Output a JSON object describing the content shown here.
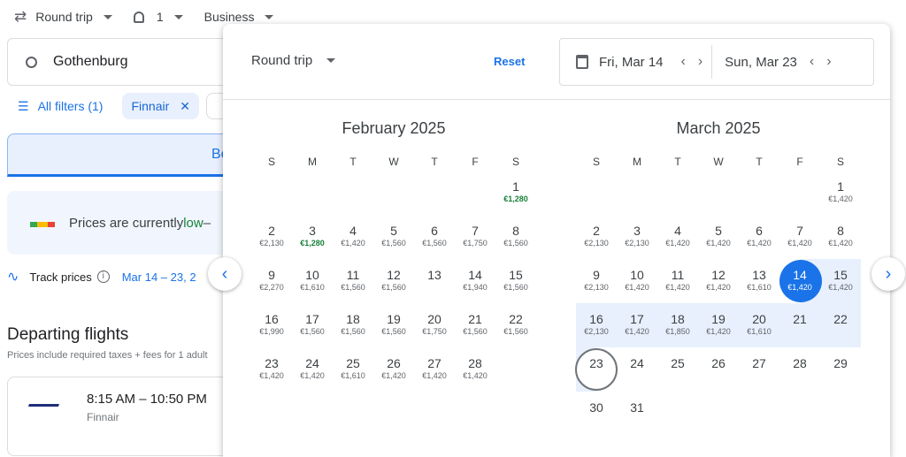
{
  "topbar": {
    "trip_type": "Round trip",
    "passengers": "1",
    "cabin": "Business"
  },
  "search": {
    "origin": "Gothenburg"
  },
  "filters": {
    "all_filters": "All filters (1)",
    "chip": "Finnair"
  },
  "tabs": {
    "best": "Be"
  },
  "insight": {
    "text_prefix": "Prices are currently ",
    "text_low": "low",
    "text_suffix": " –"
  },
  "track": {
    "label": "Track prices",
    "dates": "Mar 14 – 23, 2"
  },
  "departing": {
    "title": "Departing flights",
    "subtitle": "Prices include required taxes + fees for 1 adult"
  },
  "flight": {
    "times": "8:15 AM – 10:50 PM",
    "airline": "Finnair"
  },
  "picker": {
    "trip_type": "Round trip",
    "reset": "Reset",
    "depart": "Fri, Mar 14",
    "return": "Sun, Mar 23"
  },
  "colors": {
    "accent": "#1a73e8",
    "range": "#e8f0fe",
    "low_price": "#188038"
  },
  "weekdays": [
    "S",
    "M",
    "T",
    "W",
    "T",
    "F",
    "S"
  ],
  "months": [
    {
      "title": "February 2025",
      "offset": 6,
      "days": [
        {
          "d": "1",
          "p": "€1,280",
          "low": true
        },
        {
          "d": "2",
          "p": "€2,130"
        },
        {
          "d": "3",
          "p": "€1,280",
          "low": true
        },
        {
          "d": "4",
          "p": "€1,420"
        },
        {
          "d": "5",
          "p": "€1,560"
        },
        {
          "d": "6",
          "p": "€1,560"
        },
        {
          "d": "7",
          "p": "€1,750"
        },
        {
          "d": "8",
          "p": "€1,560"
        },
        {
          "d": "9",
          "p": "€2,270"
        },
        {
          "d": "10",
          "p": "€1,610"
        },
        {
          "d": "11",
          "p": "€1,560"
        },
        {
          "d": "12",
          "p": "€1,560"
        },
        {
          "d": "13",
          "p": ""
        },
        {
          "d": "14",
          "p": "€1,940"
        },
        {
          "d": "15",
          "p": "€1,560"
        },
        {
          "d": "16",
          "p": "€1,990"
        },
        {
          "d": "17",
          "p": "€1,560"
        },
        {
          "d": "18",
          "p": "€1,560"
        },
        {
          "d": "19",
          "p": "€1,560"
        },
        {
          "d": "20",
          "p": "€1,750"
        },
        {
          "d": "21",
          "p": "€1,560"
        },
        {
          "d": "22",
          "p": "€1,560"
        },
        {
          "d": "23",
          "p": "€1,420"
        },
        {
          "d": "24",
          "p": "€1,420"
        },
        {
          "d": "25",
          "p": "€1,610"
        },
        {
          "d": "26",
          "p": "€1,420"
        },
        {
          "d": "27",
          "p": "€1,420"
        },
        {
          "d": "28",
          "p": "€1,420"
        }
      ]
    },
    {
      "title": "March 2025",
      "offset": 6,
      "days": [
        {
          "d": "1",
          "p": "€1,420"
        },
        {
          "d": "2",
          "p": "€2,130"
        },
        {
          "d": "3",
          "p": "€2,130"
        },
        {
          "d": "4",
          "p": "€1,420"
        },
        {
          "d": "5",
          "p": "€1,420"
        },
        {
          "d": "6",
          "p": "€1,420"
        },
        {
          "d": "7",
          "p": "€1,420"
        },
        {
          "d": "8",
          "p": "€1,420"
        },
        {
          "d": "9",
          "p": "€2,130"
        },
        {
          "d": "10",
          "p": "€1,420"
        },
        {
          "d": "11",
          "p": "€1,420"
        },
        {
          "d": "12",
          "p": "€1,420"
        },
        {
          "d": "13",
          "p": "€1,610"
        },
        {
          "d": "14",
          "p": "€1,420",
          "state": "start"
        },
        {
          "d": "15",
          "p": "€1,420",
          "state": "inrange"
        },
        {
          "d": "16",
          "p": "€2,130",
          "state": "inrange"
        },
        {
          "d": "17",
          "p": "€1,420",
          "state": "inrange"
        },
        {
          "d": "18",
          "p": "€1,850",
          "state": "inrange"
        },
        {
          "d": "19",
          "p": "€1,420",
          "state": "inrange"
        },
        {
          "d": "20",
          "p": "€1,610",
          "state": "inrange"
        },
        {
          "d": "21",
          "p": "",
          "state": "inrange"
        },
        {
          "d": "22",
          "p": "",
          "state": "inrange"
        },
        {
          "d": "23",
          "p": "",
          "state": "end"
        },
        {
          "d": "24",
          "p": ""
        },
        {
          "d": "25",
          "p": ""
        },
        {
          "d": "26",
          "p": ""
        },
        {
          "d": "27",
          "p": ""
        },
        {
          "d": "28",
          "p": ""
        },
        {
          "d": "29",
          "p": ""
        },
        {
          "d": "30",
          "p": ""
        },
        {
          "d": "31",
          "p": ""
        }
      ]
    }
  ]
}
